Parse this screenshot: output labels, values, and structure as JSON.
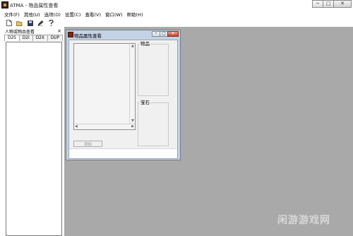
{
  "window": {
    "title": "ATMA - 物品属性查看",
    "minimize_glyph": "─",
    "maximize_glyph": "□",
    "close_glyph": "✕"
  },
  "menu": [
    "文件(F)",
    "其他(U)",
    "选项(O)",
    "设置(C)",
    "查看(V)",
    "窗口(W)",
    "帮助(H)"
  ],
  "toolbar": {
    "icons": [
      "new-file-icon",
      "open-folder-icon",
      "save-icon",
      "edit-icon",
      "help-icon"
    ]
  },
  "sidepanel": {
    "title": "人物或物品查看",
    "close_glyph": "×",
    "tabs": [
      "D2S",
      "D2I",
      "D2X",
      "DUP"
    ]
  },
  "child": {
    "title": "物品属性查看",
    "items_label": "物品",
    "gems_label": "宝石",
    "add_button": "添加"
  },
  "watermark": "闲游游戏网"
}
